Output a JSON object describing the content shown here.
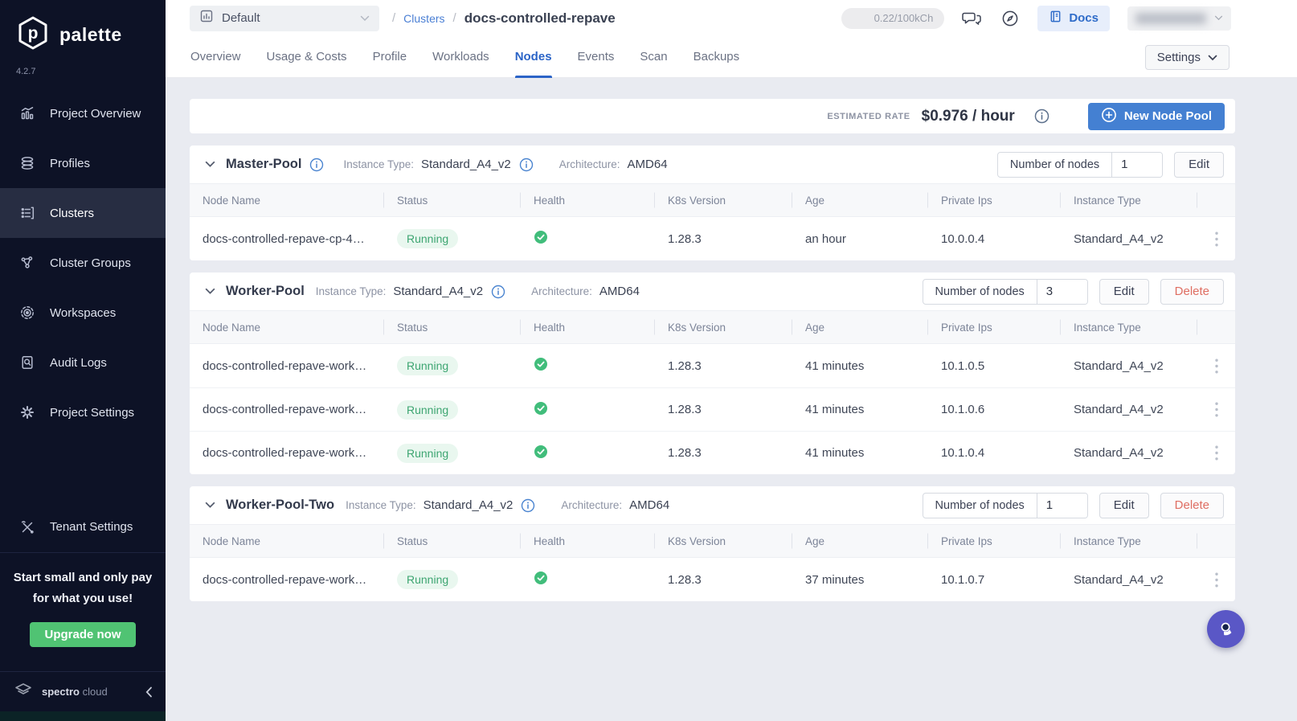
{
  "colors": {
    "accent_blue": "#4480d2",
    "link_blue": "#4a7fd4",
    "tab_active_blue": "#2b64c7",
    "success_green": "#41bd7b",
    "danger_red": "#df6e62",
    "upgrade_green": "#50c373",
    "sidebar_bg": "#0d1226",
    "fab_purple": "#5a57c6"
  },
  "sidebar": {
    "brand": "palette",
    "version": "4.2.7",
    "items": [
      {
        "label": "Project Overview",
        "icon": "bar-chart-icon"
      },
      {
        "label": "Profiles",
        "icon": "layers-icon"
      },
      {
        "label": "Clusters",
        "icon": "server-list-icon",
        "active": true
      },
      {
        "label": "Cluster Groups",
        "icon": "network-icon"
      },
      {
        "label": "Workspaces",
        "icon": "orbit-icon"
      },
      {
        "label": "Audit Logs",
        "icon": "doc-search-icon"
      },
      {
        "label": "Project Settings",
        "icon": "gear-icon"
      }
    ],
    "tenant_settings_label": "Tenant Settings",
    "promo": {
      "line1": "Start small and only pay",
      "line2": "for what you use!",
      "button_label": "Upgrade now"
    },
    "footer": {
      "brand_strong": "spectro",
      "brand_light": "cloud"
    }
  },
  "topbar": {
    "project_selector": "Default",
    "breadcrumb_sep": "/",
    "breadcrumb_link": "Clusters",
    "breadcrumb_current": "docs-controlled-repave",
    "usage_badge": "0.22/100kCh",
    "docs_label": "Docs"
  },
  "tabs": {
    "items": [
      "Overview",
      "Usage & Costs",
      "Profile",
      "Workloads",
      "Nodes",
      "Events",
      "Scan",
      "Backups"
    ],
    "active": "Nodes",
    "settings_label": "Settings"
  },
  "rate_bar": {
    "label": "ESTIMATED RATE",
    "value": "$0.976 / hour",
    "new_pool_label": "New Node Pool"
  },
  "labels": {
    "instance_type": "Instance Type:",
    "architecture": "Architecture:",
    "number_of_nodes": "Number of nodes",
    "edit": "Edit",
    "delete": "Delete"
  },
  "table": {
    "headers": [
      "Node Name",
      "Status",
      "Health",
      "K8s Version",
      "Age",
      "Private Ips",
      "Instance Type"
    ]
  },
  "pools": [
    {
      "name": "Master-Pool",
      "instance_type": "Standard_A4_v2",
      "architecture": "AMD64",
      "nodes_count": "1",
      "rows": [
        {
          "name": "docs-controlled-repave-cp-4…",
          "status": "Running",
          "k8s_version": "1.28.3",
          "age": "an hour",
          "private_ip": "10.0.0.4",
          "instance_type": "Standard_A4_v2"
        }
      ]
    },
    {
      "name": "Worker-Pool",
      "instance_type": "Standard_A4_v2",
      "architecture": "AMD64",
      "nodes_count": "3",
      "rows": [
        {
          "name": "docs-controlled-repave-work…",
          "status": "Running",
          "k8s_version": "1.28.3",
          "age": "41 minutes",
          "private_ip": "10.1.0.5",
          "instance_type": "Standard_A4_v2"
        },
        {
          "name": "docs-controlled-repave-work…",
          "status": "Running",
          "k8s_version": "1.28.3",
          "age": "41 minutes",
          "private_ip": "10.1.0.6",
          "instance_type": "Standard_A4_v2"
        },
        {
          "name": "docs-controlled-repave-work…",
          "status": "Running",
          "k8s_version": "1.28.3",
          "age": "41 minutes",
          "private_ip": "10.1.0.4",
          "instance_type": "Standard_A4_v2"
        }
      ]
    },
    {
      "name": "Worker-Pool-Two",
      "instance_type": "Standard_A4_v2",
      "architecture": "AMD64",
      "nodes_count": "1",
      "rows": [
        {
          "name": "docs-controlled-repave-work…",
          "status": "Running",
          "k8s_version": "1.28.3",
          "age": "37 minutes",
          "private_ip": "10.1.0.7",
          "instance_type": "Standard_A4_v2"
        }
      ]
    }
  ]
}
